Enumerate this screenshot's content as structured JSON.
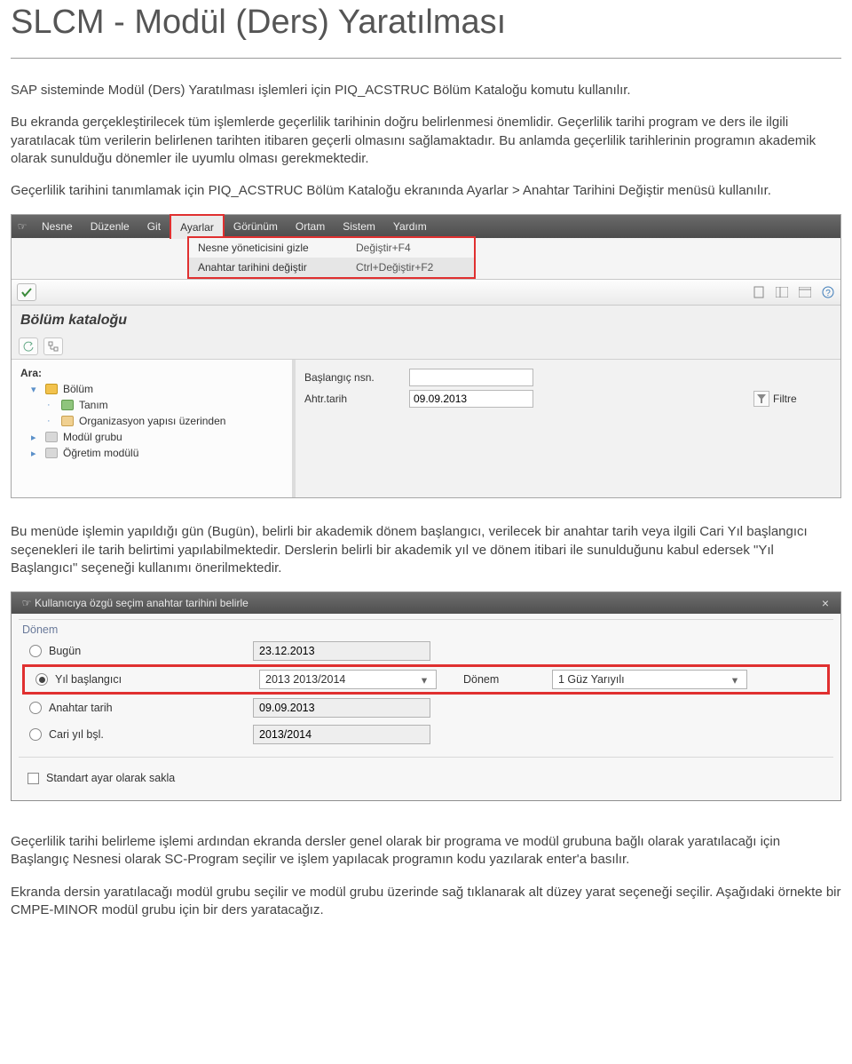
{
  "title": "SLCM - Modül (Ders) Yaratılması",
  "paragraphs": {
    "p1": "SAP sisteminde Modül (Ders) Yaratılması işlemleri için PIQ_ACSTRUC Bölüm Kataloğu komutu kullanılır.",
    "p2": "Bu ekranda gerçekleştirilecek tüm işlemlerde geçerlilik tarihinin doğru belirlenmesi önemlidir. Geçerlilik tarihi program ve ders ile ilgili yaratılacak tüm verilerin belirlenen tarihten itibaren geçerli olmasını sağlamaktadır. Bu anlamda geçerlilik tarihlerinin programın akademik olarak sunulduğu dönemler ile uyumlu olması gerekmektedir.",
    "p3": "Geçerlilik tarihini tanımlamak için PIQ_ACSTRUC Bölüm Kataloğu ekranında Ayarlar > Anahtar Tarihini Değiştir menüsü kullanılır.",
    "p4": "Bu menüde işlemin yapıldığı gün (Bugün), belirli bir akademik dönem başlangıcı, verilecek bir anahtar tarih veya ilgili Cari Yıl başlangıcı seçenekleri ile tarih belirtimi yapılabilmektedir. Derslerin belirli bir akademik yıl ve dönem itibari ile sunulduğunu kabul edersek \"Yıl Başlangıcı\" seçeneği kullanımı önerilmektedir.",
    "p5": "Geçerlilik tarihi belirleme işlemi ardından ekranda dersler genel olarak bir programa ve modül grubuna bağlı olarak yaratılacağı için Başlangıç Nesnesi olarak SC-Program seçilir ve işlem yapılacak programın kodu yazılarak enter'a basılır.",
    "p6": "Ekranda dersin yaratılacağı modül grubu seçilir ve modül grubu üzerinde sağ tıklanarak alt düzey yarat seçeneği seçilir. Aşağıdaki örnekte bir CMPE-MINOR modül grubu için bir ders yaratacağız."
  },
  "screenshot1": {
    "menu_items": {
      "corner": "☞",
      "nesne": "Nesne",
      "duzenle": "Düzenle",
      "git": "Git",
      "ayarlar": "Ayarlar",
      "gorunum": "Görünüm",
      "ortam": "Ortam",
      "sistem": "Sistem",
      "yardim": "Yardım"
    },
    "dropdown": {
      "row1_left": "Nesne yöneticisini gizle",
      "row1_right": "Değiştir+F4",
      "row2_left": "Anahtar tarihini değiştir",
      "row2_right": "Ctrl+Değiştir+F2"
    },
    "window_title": "Bölüm kataloğu",
    "tree": {
      "search_label": "Ara:",
      "bolum": "Bölüm",
      "tanim": "Tanım",
      "org_yapisi": "Organizasyon yapısı üzerinden",
      "modul_grubu": "Modül grubu",
      "ogretim_modulu": "Öğretim modülü"
    },
    "right": {
      "baslangic_label": "Başlangıç nsn.",
      "ahtr_label": "Ahtr.tarih",
      "ahtr_value": "09.09.2013",
      "filtre_label": "Filtre"
    }
  },
  "screenshot2": {
    "dialog_title": "Kullanıcıya özgü seçim anahtar tarihini belirle",
    "section_label": "Dönem",
    "rows": {
      "bugun_label": "Bugün",
      "bugun_value": "23.12.2013",
      "yil_label": "Yıl başlangıcı",
      "yil_value": "2013 2013/2014",
      "donem_label": "Dönem",
      "donem_value": "1 Güz Yarıyılı",
      "anahtar_label": "Anahtar tarih",
      "anahtar_value": "09.09.2013",
      "cari_label": "Cari yıl bşl.",
      "cari_value": "2013/2014"
    },
    "checkbox_label": "Standart ayar olarak sakla"
  }
}
